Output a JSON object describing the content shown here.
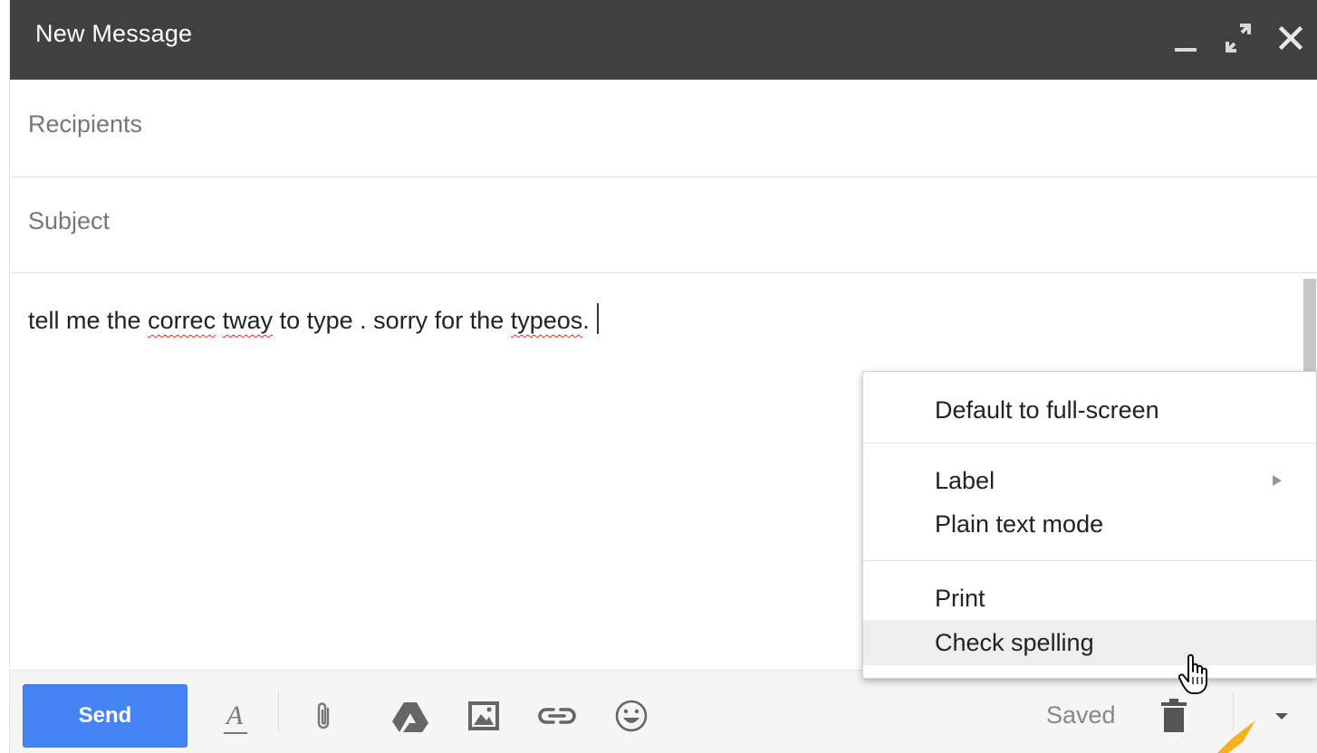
{
  "window": {
    "title": "New Message",
    "controls": {
      "minimize": "minimize-icon",
      "expand": "expand-icon",
      "close": "close-icon"
    }
  },
  "fields": {
    "recipients_placeholder": "Recipients",
    "subject_placeholder": "Subject"
  },
  "body": {
    "segments": [
      {
        "text": "tell me the ",
        "misspelled": false
      },
      {
        "text": "correc",
        "misspelled": true
      },
      {
        "text": " ",
        "misspelled": false
      },
      {
        "text": "tway",
        "misspelled": true
      },
      {
        "text": " to type . sorry for the ",
        "misspelled": false
      },
      {
        "text": "typeos",
        "misspelled": true
      },
      {
        "text": ".",
        "misspelled": false
      }
    ]
  },
  "more_options_menu": {
    "items": [
      {
        "label": "Default to full-screen"
      },
      {
        "label": "Label",
        "submenu": true
      },
      {
        "label": "Plain text mode"
      },
      {
        "label": "Print"
      },
      {
        "label": "Check spelling",
        "hovered": true
      }
    ]
  },
  "toolbar": {
    "send_label": "Send",
    "format_icon_glyph": "A",
    "status": "Saved",
    "icons": [
      "formatting-icon",
      "attach-icon",
      "drive-icon",
      "photo-icon",
      "link-icon",
      "emoji-icon",
      "trash-icon",
      "more-options-icon"
    ]
  },
  "colors": {
    "titlebar": "#404040",
    "send_button": "#4585f3",
    "misspell_underline": "#d93025",
    "annotation_arrow": "#f6b21b"
  }
}
